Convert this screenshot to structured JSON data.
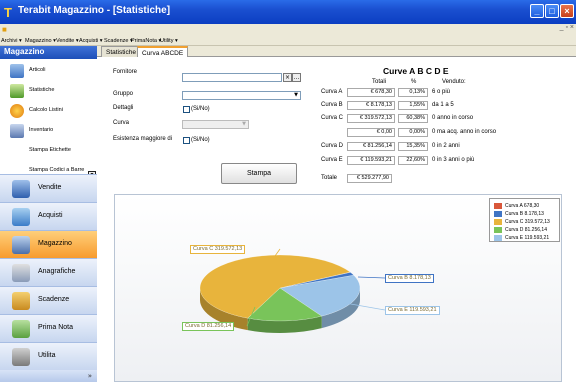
{
  "window": {
    "title": "Terabit Magazzino - [Statistiche]",
    "icon_glyph": "T"
  },
  "menu": [
    "Archivi ▾",
    "Magazzino ▾",
    "Vendite ▾",
    "Acquisti ▾",
    "Scadenze ▾",
    "PrimaNota ▾",
    "Utility ▾"
  ],
  "sidebar": {
    "header": "Magazzino",
    "items": [
      "Articoli",
      "Statistiche",
      "Calcolo Listini",
      "Inventario",
      "Stampa Etichette",
      "Stampa Codici a Barre"
    ],
    "nav": [
      "Vendite",
      "Acquisti",
      "Magazzino",
      "Anagrafiche",
      "Scadenze",
      "Prima Nota",
      "Utilita"
    ],
    "active_nav": "Magazzino"
  },
  "tabs": [
    "Statistiche",
    "Curva ABCDE"
  ],
  "active_tab": "Curva ABCDE",
  "form": {
    "fornitore_label": "Fornitore",
    "gruppo_label": "Gruppo",
    "dettagli_label": "Dettagli",
    "dettagli_check": "(Si/No)",
    "curva_label": "Curva",
    "esistenza_label": "Esistenza maggiore di",
    "esistenza_check": "(Si/No)",
    "stampa_button": "Stampa"
  },
  "curve_table": {
    "title": "Curve A B C D E",
    "headers": {
      "totali": "Totali",
      "pct": "%",
      "venduto": "Venduto:"
    },
    "rows": [
      {
        "label": "Curva A",
        "totale": "€ 678,30",
        "pct": "0,13%",
        "venduto": "6 o più"
      },
      {
        "label": "Curva B",
        "totale": "€ 8.178,13",
        "pct": "1,55%",
        "venduto": "da 1 a 5"
      },
      {
        "label": "Curva C",
        "totale": "€ 319.572,13",
        "pct": "60,38%",
        "venduto": "0 anno in corso"
      },
      {
        "label": "",
        "totale": "€ 0,00",
        "pct": "0,00%",
        "venduto": "0 ma acq. anno in corso"
      },
      {
        "label": "Curva D",
        "totale": "€ 81.256,14",
        "pct": "15,35%",
        "venduto": "0 in 2 anni"
      },
      {
        "label": "Curva E",
        "totale": "€ 119.593,21",
        "pct": "22,60%",
        "venduto": "0 in 3 anni o più"
      }
    ],
    "totale_label": "Totale",
    "totale_value": "€ 529.277,90"
  },
  "chart_data": {
    "type": "pie",
    "categories": [
      "Curva A",
      "Curva B",
      "Curva C",
      "Curva D",
      "Curva E"
    ],
    "values": [
      678.3,
      8178.13,
      319572.13,
      81256.14,
      119593.21
    ],
    "colors": [
      "#d9573a",
      "#3f74c4",
      "#e8b43c",
      "#79c45a",
      "#9cc4e8"
    ],
    "legend": [
      "Curva A  678,30",
      "Curva B  8.178,13",
      "Curva C  319.572,13",
      "Curva D  81.256,14",
      "Curva E  119.593,21"
    ],
    "legend_position": "top-right",
    "callouts": {
      "B": "Curva B  8.178,13",
      "C": "Curva C  319.572,13",
      "D": "Curva D  81.256,14",
      "E": "Curva E  119.593,21"
    }
  }
}
